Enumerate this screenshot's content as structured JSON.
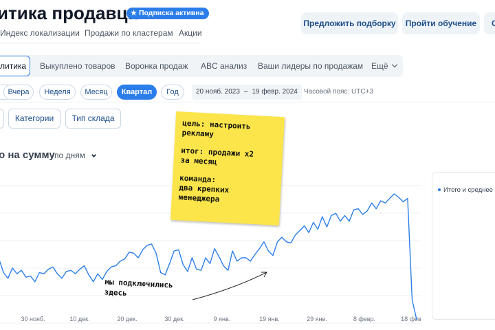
{
  "header": {
    "title": "итика продавца",
    "subscription_badge": "Подписка активна",
    "nav": [
      "Индекс локализации",
      "Продажи по кластерам",
      "Акции"
    ],
    "actions": [
      "Предложить подборку",
      "Пройти обучение",
      "С"
    ]
  },
  "tabs": {
    "items": [
      "литика",
      "Выкуплено товаров",
      "Воронка продаж",
      "ABC анализ",
      "Ваши лидеры по продажам",
      "Ещё"
    ],
    "active_index": 0
  },
  "periods": {
    "items": [
      "",
      "Вчера",
      "Неделя",
      "Месяц",
      "Квартал",
      "Год"
    ],
    "active": "Квартал",
    "date_from": "20 нояб. 2023",
    "date_sep": "–",
    "date_to": "19 февр. 2024",
    "timezone": "Часовой пояс: UTC+3"
  },
  "filters": [
    "",
    "Категории",
    "Тип склада"
  ],
  "chart_header": {
    "title": "о на сумму",
    "period_select": "по дням"
  },
  "legend": {
    "item": "Итого и среднее",
    "color": "#2b7de9"
  },
  "sticky_note": {
    "goal": "цель: настроить\nрекламу",
    "result": "итог: продажи x2\nза месяц",
    "team": "команда:\nдва крепких\nменеджера"
  },
  "annotation": "мы подключились\nздесь",
  "chart_data": {
    "type": "line",
    "title": "",
    "xlabel": "",
    "ylabel": "",
    "line_color": "#2b7de9",
    "x_ticks": [
      "30 нояб.",
      "10 дек.",
      "20 дек.",
      "30 дек.",
      "9 янв.",
      "19 янв.",
      "29 янв.",
      "8 февр.",
      "18 фев"
    ],
    "ylim": [
      0,
      100
    ],
    "values": [
      38,
      43,
      31,
      26,
      35,
      30,
      33,
      27,
      28,
      23,
      31,
      30,
      34,
      36,
      30,
      26,
      32,
      33,
      30,
      34,
      37,
      29,
      23,
      30,
      25,
      32,
      36,
      37,
      41,
      43,
      49,
      48,
      44,
      51,
      55,
      56,
      48,
      31,
      29,
      39,
      50,
      51,
      38,
      32,
      44,
      34,
      33,
      44,
      39,
      52,
      45,
      37,
      33,
      50,
      41,
      44,
      44,
      41,
      47,
      52,
      58,
      50,
      46,
      58,
      62,
      58,
      57,
      64,
      68,
      72,
      66,
      75,
      69,
      80,
      71,
      81,
      83,
      76,
      81,
      76,
      86,
      87,
      82,
      85,
      92,
      87,
      94,
      92,
      96,
      100,
      97,
      93,
      96,
      7,
      -10
    ],
    "last_day": "19 февр. 2024"
  }
}
